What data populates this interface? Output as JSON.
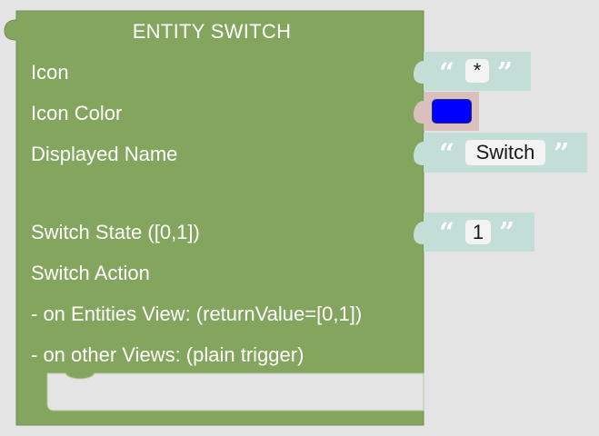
{
  "block": {
    "title": "ENTITY SWITCH",
    "block_color": "#83a55d",
    "text_color": "#ffffff",
    "labels": {
      "icon": "Icon",
      "icon_color": "Icon Color",
      "displayed_name": "Displayed Name",
      "switch_state": "Switch State ([0,1])",
      "switch_action": "Switch Action",
      "on_entities_view": "- on Entities View: (returnValue=[0,1])",
      "on_other_views": "- on other Views: (plain trigger)"
    }
  },
  "inputs": {
    "icon": {
      "value": "*",
      "open_quote": "“",
      "close_quote": "”"
    },
    "icon_color": {
      "value_color": "#0000ff",
      "block_color": "#d9c0bc"
    },
    "displayed_name": {
      "value": "Switch",
      "open_quote": "“",
      "close_quote": "”"
    },
    "switch_state": {
      "value": "1",
      "open_quote": "“",
      "close_quote": "”"
    },
    "text_block_color": "#c2ded6"
  }
}
